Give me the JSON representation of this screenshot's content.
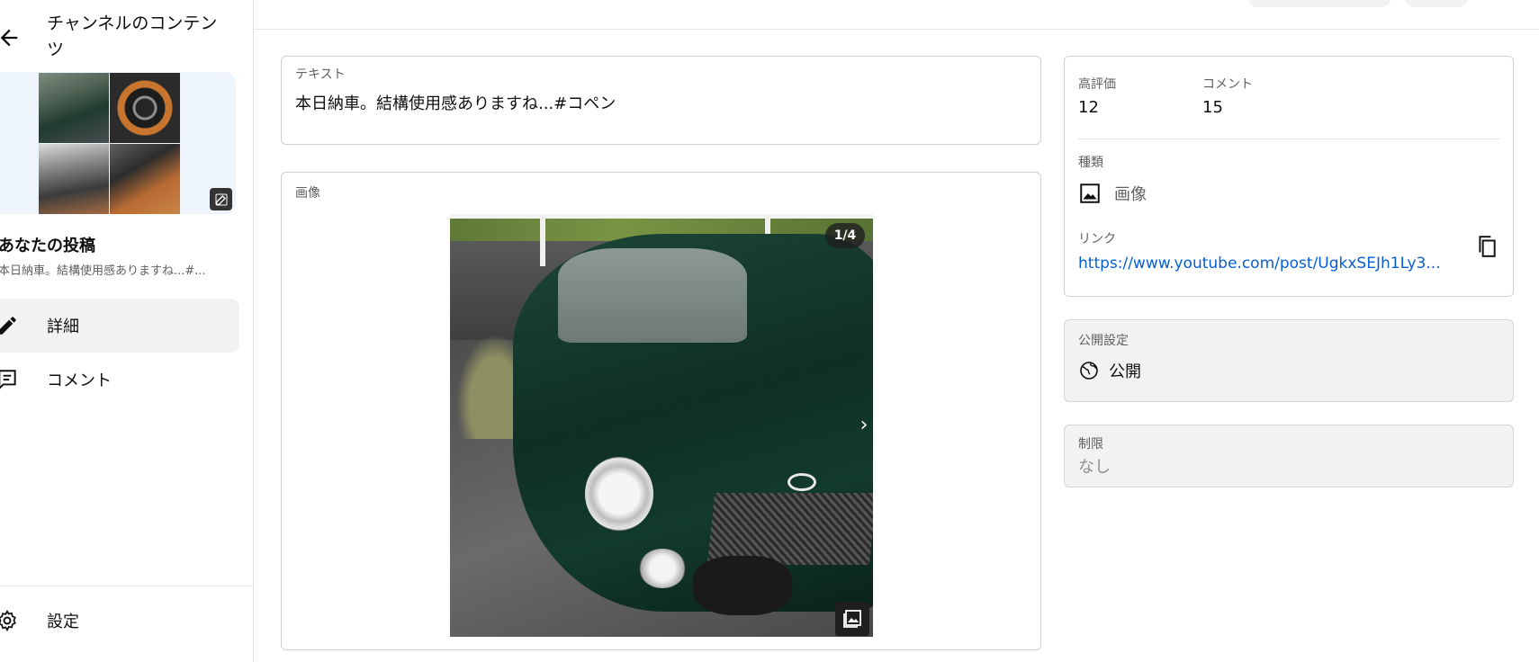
{
  "sidebar": {
    "title": "チャンネルのコンテンツ",
    "post_title": "あなたの投稿",
    "post_snippet": "本日納車。結構使用感ありますね...#...",
    "nav": [
      {
        "label": "詳細",
        "icon": "pencil-icon",
        "active": true
      },
      {
        "label": "コメント",
        "icon": "comment-icon",
        "active": false
      }
    ],
    "settings_label": "設定"
  },
  "text_section": {
    "label": "テキスト",
    "value": "本日納車。結構使用感ありますね...#コペン"
  },
  "image_section": {
    "label": "画像",
    "counter": "1/4"
  },
  "stats": {
    "likes_label": "高評価",
    "likes": "12",
    "comments_label": "コメント",
    "comments": "15",
    "type_label": "種類",
    "type_value": "画像",
    "link_label": "リンク",
    "link_value": "https://www.youtube.com/post/UgkxSEJh1Ly3..."
  },
  "visibility": {
    "label": "公開設定",
    "value": "公開"
  },
  "restriction": {
    "label": "制限",
    "value": "なし"
  },
  "colors": {
    "link": "#065fd4",
    "active_nav_bg": "#f2f2f2"
  }
}
